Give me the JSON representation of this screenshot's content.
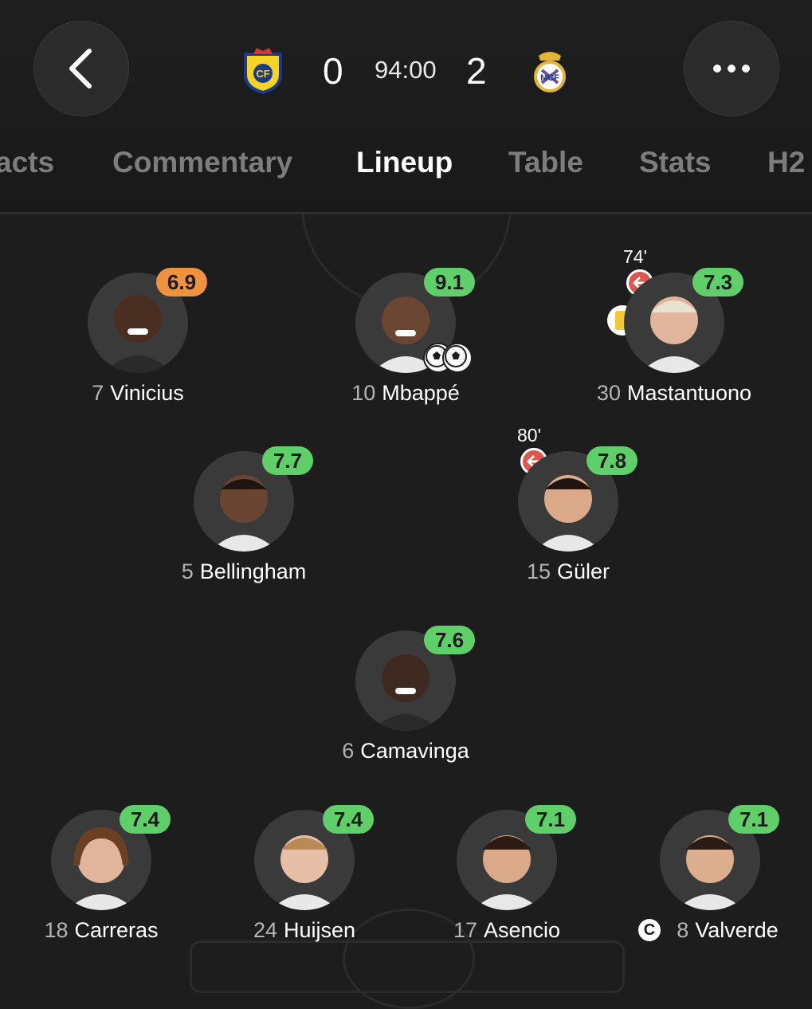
{
  "header": {
    "home_score": "0",
    "away_score": "2",
    "clock": "94:00",
    "home_crest_icon": "villarreal-crest",
    "away_crest_icon": "real-madrid-crest",
    "back_icon": "chevron-left-icon",
    "more_icon": "more-horizontal-icon"
  },
  "tabs": [
    {
      "label": "acts"
    },
    {
      "label": "Commentary"
    },
    {
      "label": "Lineup"
    },
    {
      "label": "Table"
    },
    {
      "label": "Stats"
    },
    {
      "label": "H2"
    }
  ],
  "active_tab": "Lineup",
  "colors": {
    "rating_green": "#5fcf6a",
    "rating_orange": "#f0913d",
    "sub_red": "#e0564e",
    "yellow_card": "#f2c837",
    "background": "#1d1d1d"
  },
  "players": [
    {
      "number": "7",
      "name": "Vinicius",
      "rating": "6.9",
      "rating_color": "orange"
    },
    {
      "number": "10",
      "name": "Mbappé",
      "rating": "9.1",
      "rating_color": "green",
      "goals": 2
    },
    {
      "number": "30",
      "name": "Mastantuono",
      "rating": "7.3",
      "rating_color": "green",
      "sub_minute": "74'",
      "yellow_card": true
    },
    {
      "number": "5",
      "name": "Bellingham",
      "rating": "7.7",
      "rating_color": "green"
    },
    {
      "number": "15",
      "name": "Güler",
      "rating": "7.8",
      "rating_color": "green",
      "sub_minute": "80'"
    },
    {
      "number": "6",
      "name": "Camavinga",
      "rating": "7.6",
      "rating_color": "green"
    },
    {
      "number": "18",
      "name": "Carreras",
      "rating": "7.4",
      "rating_color": "green"
    },
    {
      "number": "24",
      "name": "Huijsen",
      "rating": "7.4",
      "rating_color": "green"
    },
    {
      "number": "17",
      "name": "Asencio",
      "rating": "7.1",
      "rating_color": "green"
    },
    {
      "number": "8",
      "name": "Valverde",
      "rating": "7.1",
      "rating_color": "green",
      "captain": true
    }
  ],
  "captain_badge": "C"
}
